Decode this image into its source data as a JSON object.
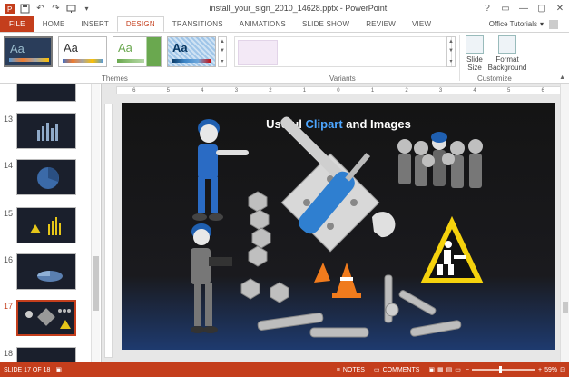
{
  "window": {
    "title": "install_your_sign_2010_14628.pptx - PowerPoint",
    "controls": [
      "?",
      "▭",
      "—",
      "▢",
      "✕"
    ]
  },
  "qat_icons": [
    "powerpoint-logo-icon",
    "save-icon",
    "undo-icon",
    "redo-icon",
    "present-icon",
    "customize-icon"
  ],
  "tabs": [
    {
      "label": "FILE"
    },
    {
      "label": "HOME"
    },
    {
      "label": "INSERT"
    },
    {
      "label": "DESIGN"
    },
    {
      "label": "TRANSITIONS"
    },
    {
      "label": "ANIMATIONS"
    },
    {
      "label": "SLIDE SHOW"
    },
    {
      "label": "REVIEW"
    },
    {
      "label": "VIEW"
    }
  ],
  "account": "Office Tutorials",
  "ribbon": {
    "themes_label": "Themes",
    "variants_label": "Variants",
    "customize_label": "Customize",
    "theme_aa": [
      "Aa",
      "Aa",
      "Aa",
      "Aa"
    ],
    "slide_size_label": "Slide\nSize",
    "format_bg_label": "Format\nBackground"
  },
  "thumbnails": [
    {
      "num": "13"
    },
    {
      "num": "14"
    },
    {
      "num": "15"
    },
    {
      "num": "16"
    },
    {
      "num": "17",
      "selected": true
    },
    {
      "num": "18"
    }
  ],
  "ruler_ticks": [
    "6",
    "5",
    "4",
    "3",
    "2",
    "1",
    "0",
    "1",
    "2",
    "3",
    "4",
    "5",
    "6"
  ],
  "slide": {
    "title_a": "Useful ",
    "title_b": "Clipart",
    "title_c": " and Images"
  },
  "status": {
    "slide_info": "SLIDE 17 OF 18",
    "notes": "NOTES",
    "comments": "COMMENTS",
    "zoom": "59%",
    "zoom_fraction": 0.59
  },
  "colors": {
    "accent": "#c43e1c",
    "title_highlight": "#4da6ff"
  }
}
